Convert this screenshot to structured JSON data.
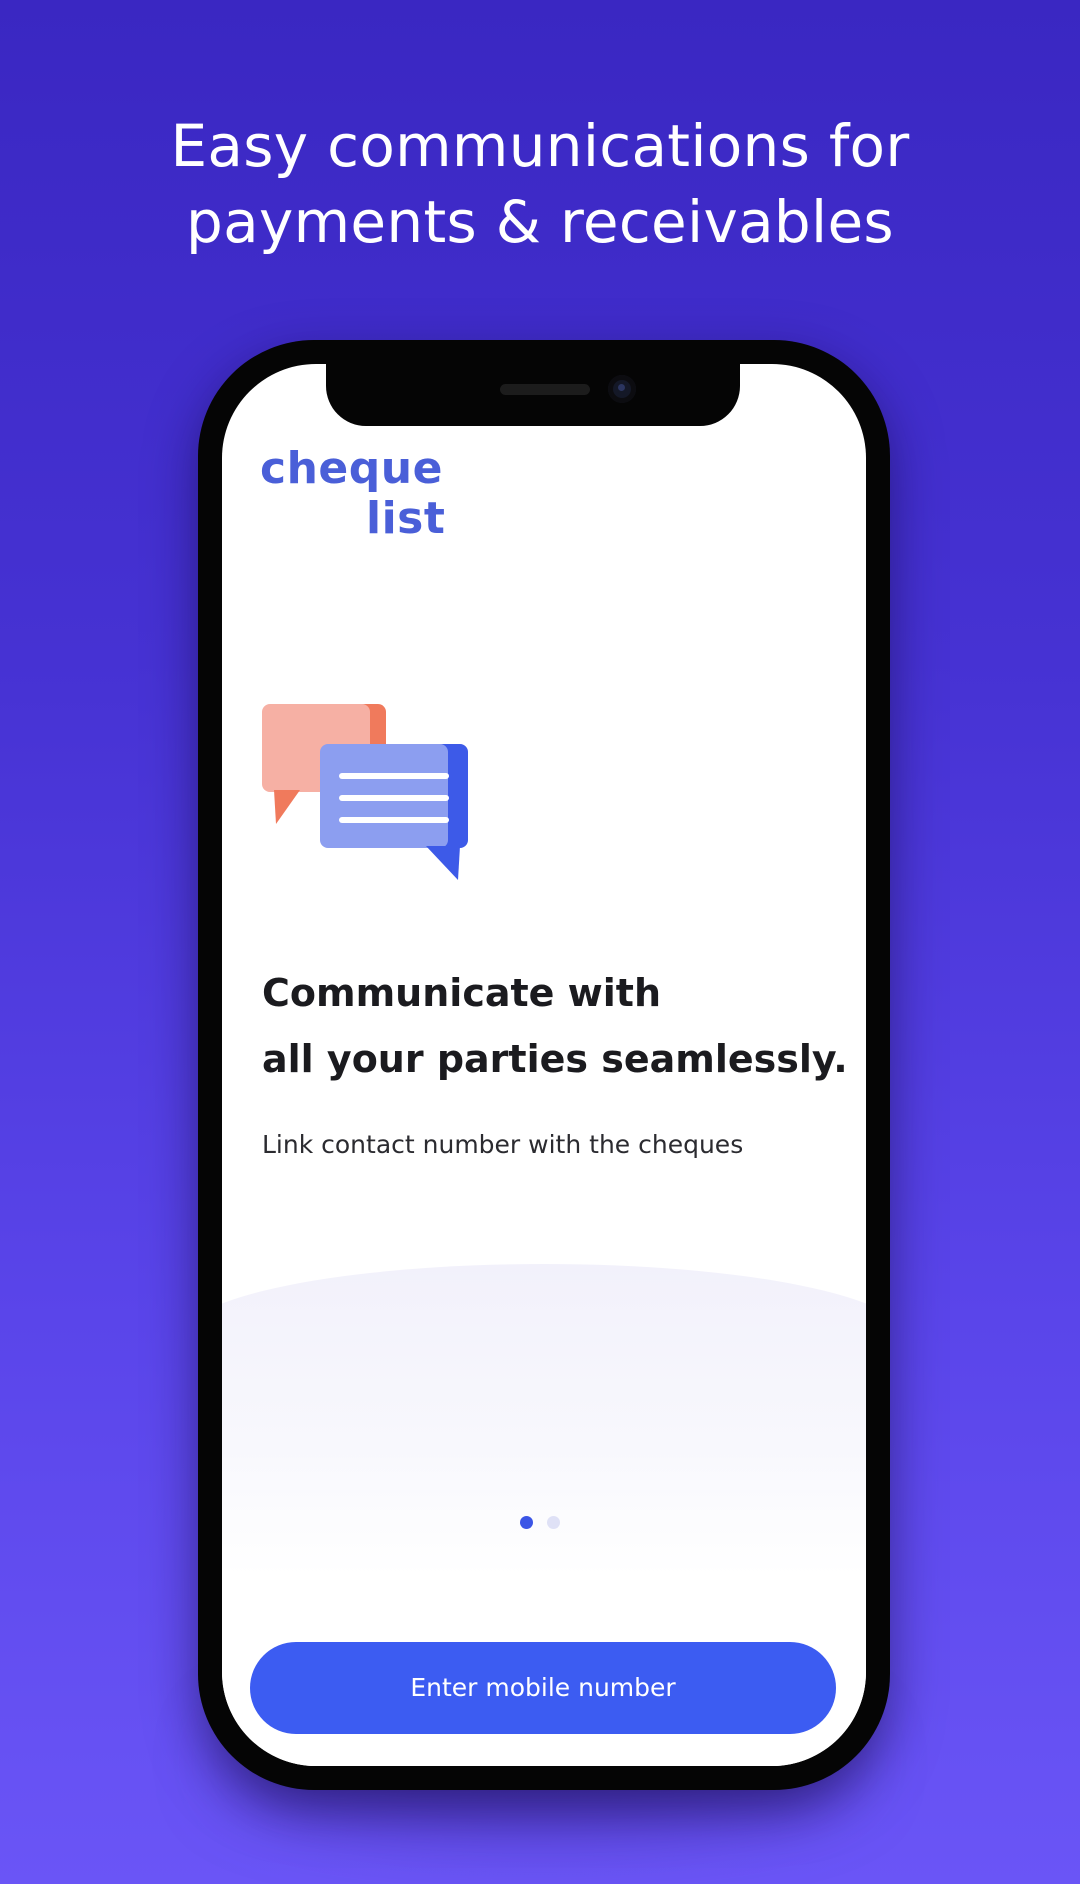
{
  "headline": {
    "line1": "Easy communications for",
    "line2": "payments & receivables"
  },
  "app": {
    "logo_line1": "cheque",
    "logo_line2": "list"
  },
  "onboarding": {
    "illustration": "chat-bubbles-icon",
    "title_line1": "Communicate with",
    "title_line2": "all your parties seamlessly.",
    "subtitle": "Link contact number with the cheques",
    "page_count": 2,
    "active_page": 1
  },
  "cta": {
    "label": "Enter mobile number"
  },
  "colors": {
    "background_top": "#3a27c2",
    "background_bottom": "#6a55f6",
    "brand_blue": "#4a5fd8",
    "button": "#3c5cf2",
    "bubble_back": "#f6b0a4",
    "bubble_back_accent": "#f07a5c",
    "bubble_front": "#8c9ef0",
    "bubble_front_accent": "#3d5ae8"
  }
}
